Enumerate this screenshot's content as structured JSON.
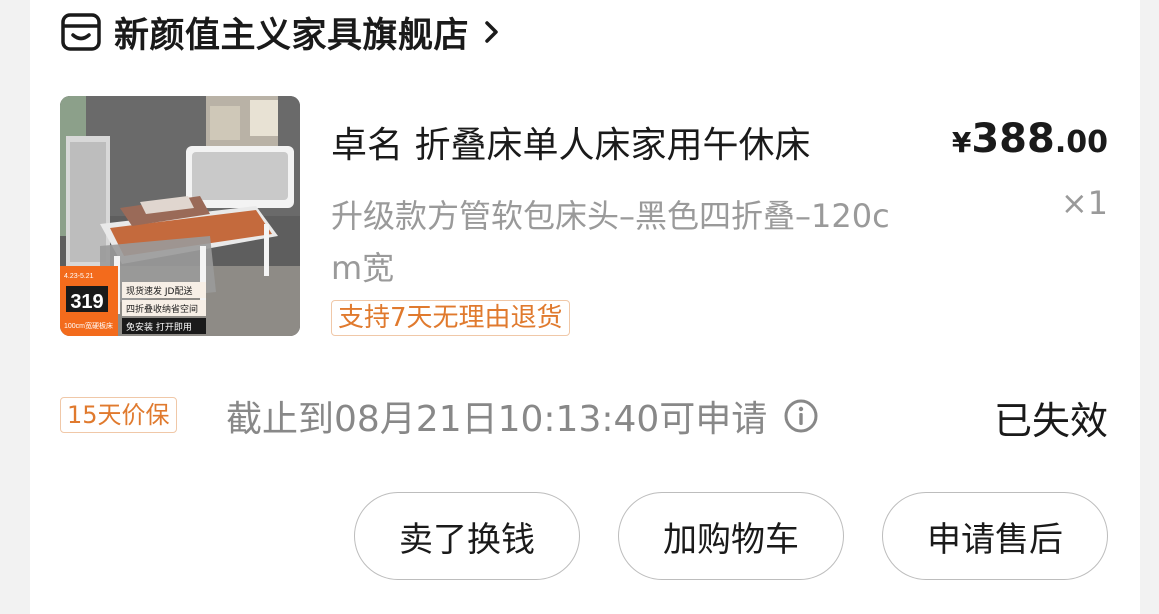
{
  "shop": {
    "name": "新颜值主义家具旗舰店",
    "icon": "store-icon"
  },
  "product": {
    "title": "卓名 折叠床单人床家用午休床",
    "spec": "升级款方管软包床头–黑色四折叠–120cm宽",
    "return_policy": "支持7天无理由退货",
    "price": {
      "currency": "¥",
      "integer": "388",
      "decimal": ".00"
    },
    "quantity": "×1",
    "image": {
      "price_badge": "319",
      "badge_lines": [
        "现货速发 JD配送",
        "四折叠收纳省空间",
        "免安装  打开即用"
      ],
      "size_note": "100cm宽硬板床",
      "date_note": "4.23-5.21"
    }
  },
  "price_protection": {
    "tag": "15天价保",
    "deadline": "截止到08月21日10:13:40可申请",
    "status": "已失效"
  },
  "actions": {
    "sell": "卖了换钱",
    "add_cart": "加购物车",
    "after_sale": "申请售后"
  },
  "colors": {
    "accent": "#e07a2e",
    "text": "#1a1a1a",
    "muted": "#9a9a9a"
  }
}
